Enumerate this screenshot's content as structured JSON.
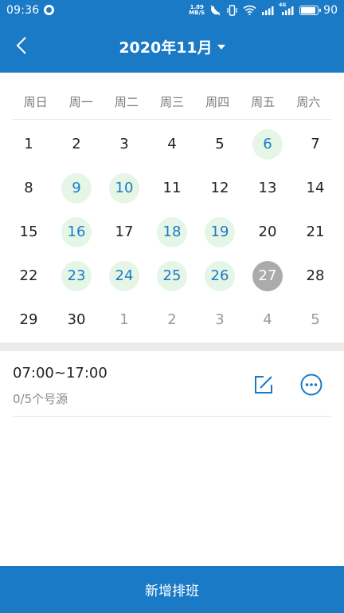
{
  "status_bar": {
    "time": "09:36",
    "net_speed_value": "1.89",
    "net_speed_unit": "MB/S",
    "signal_2_label": "4G",
    "battery_level": "90"
  },
  "header": {
    "title": "2020年11月"
  },
  "calendar": {
    "weekdays": [
      "周日",
      "周一",
      "周二",
      "周三",
      "周四",
      "周五",
      "周六"
    ],
    "weeks": [
      [
        {
          "d": "1",
          "s": ""
        },
        {
          "d": "2",
          "s": ""
        },
        {
          "d": "3",
          "s": ""
        },
        {
          "d": "4",
          "s": ""
        },
        {
          "d": "5",
          "s": ""
        },
        {
          "d": "6",
          "s": "has-schedule"
        },
        {
          "d": "7",
          "s": ""
        }
      ],
      [
        {
          "d": "8",
          "s": ""
        },
        {
          "d": "9",
          "s": "has-schedule"
        },
        {
          "d": "10",
          "s": "has-schedule"
        },
        {
          "d": "11",
          "s": ""
        },
        {
          "d": "12",
          "s": ""
        },
        {
          "d": "13",
          "s": ""
        },
        {
          "d": "14",
          "s": ""
        }
      ],
      [
        {
          "d": "15",
          "s": ""
        },
        {
          "d": "16",
          "s": "has-schedule"
        },
        {
          "d": "17",
          "s": ""
        },
        {
          "d": "18",
          "s": "has-schedule"
        },
        {
          "d": "19",
          "s": "has-schedule"
        },
        {
          "d": "20",
          "s": ""
        },
        {
          "d": "21",
          "s": ""
        }
      ],
      [
        {
          "d": "22",
          "s": ""
        },
        {
          "d": "23",
          "s": "has-schedule"
        },
        {
          "d": "24",
          "s": "has-schedule"
        },
        {
          "d": "25",
          "s": "has-schedule"
        },
        {
          "d": "26",
          "s": "has-schedule"
        },
        {
          "d": "27",
          "s": "selected"
        },
        {
          "d": "28",
          "s": ""
        }
      ],
      [
        {
          "d": "29",
          "s": ""
        },
        {
          "d": "30",
          "s": ""
        },
        {
          "d": "1",
          "s": "other-month"
        },
        {
          "d": "2",
          "s": "other-month"
        },
        {
          "d": "3",
          "s": "other-month"
        },
        {
          "d": "4",
          "s": "other-month"
        },
        {
          "d": "5",
          "s": "other-month"
        }
      ]
    ]
  },
  "schedule": {
    "time_range": "07:00~17:00",
    "quota": "0/5个号源"
  },
  "bottom": {
    "add_label": "新增排班"
  },
  "colors": {
    "brand": "#1a7ac6",
    "scheduled_bg": "#e6f6e6",
    "selected_bg": "#ababab"
  },
  "icons": {
    "back": "chevron-left-icon",
    "dropdown": "caret-down-icon",
    "edit": "edit-icon",
    "more": "more-circle-icon"
  }
}
